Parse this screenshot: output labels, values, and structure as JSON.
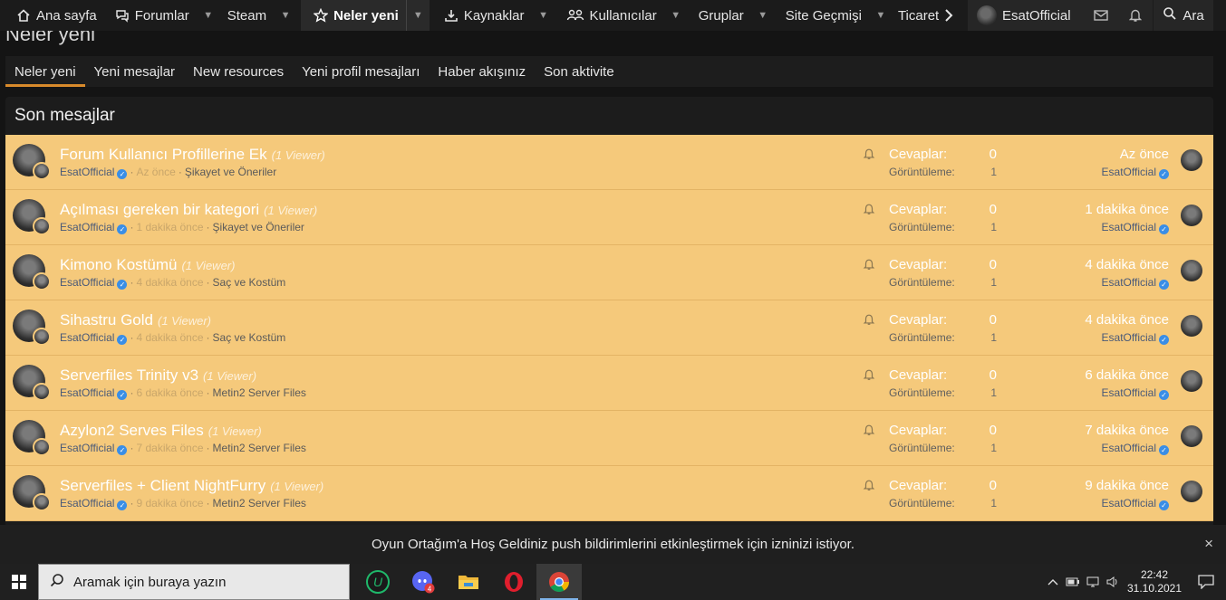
{
  "nav": {
    "home": "Ana sayfa",
    "forums": "Forumlar",
    "steam": "Steam",
    "whats_new": "Neler yeni",
    "resources": "Kaynaklar",
    "members": "Kullanıcılar",
    "groups": "Gruplar",
    "site_history": "Site Geçmişi",
    "trade": "Ticaret",
    "user": "EsatOfficial",
    "search": "Ara"
  },
  "page_heading": "Neler yeni",
  "tabs": [
    "Neler yeni",
    "Yeni mesajlar",
    "New resources",
    "Yeni profil mesajları",
    "Haber akışınız",
    "Son aktivite"
  ],
  "block_title": "Son mesajlar",
  "labels": {
    "replies": "Cevaplar:",
    "views": "Görüntüleme:"
  },
  "threads": [
    {
      "title": "Forum Kullanıcı Profillerine Ek",
      "viewers": "(1 Viewer)",
      "author": "EsatOfficial",
      "time": "Az önce",
      "forum": "Şikayet ve Öneriler",
      "replies": "0",
      "views": "1",
      "last_time": "Az önce",
      "last_user": "EsatOfficial"
    },
    {
      "title": "Açılması gereken bir kategori",
      "viewers": "(1 Viewer)",
      "author": "EsatOfficial",
      "time": "1 dakika önce",
      "forum": "Şikayet ve Öneriler",
      "replies": "0",
      "views": "1",
      "last_time": "1 dakika önce",
      "last_user": "EsatOfficial"
    },
    {
      "title": "Kimono Kostümü",
      "viewers": "(1 Viewer)",
      "author": "EsatOfficial",
      "time": "4 dakika önce",
      "forum": "Saç ve Kostüm",
      "replies": "0",
      "views": "1",
      "last_time": "4 dakika önce",
      "last_user": "EsatOfficial"
    },
    {
      "title": "Sihastru Gold",
      "viewers": "(1 Viewer)",
      "author": "EsatOfficial",
      "time": "4 dakika önce",
      "forum": "Saç ve Kostüm",
      "replies": "0",
      "views": "1",
      "last_time": "4 dakika önce",
      "last_user": "EsatOfficial"
    },
    {
      "title": "Serverfiles Trinity v3",
      "viewers": "(1 Viewer)",
      "author": "EsatOfficial",
      "time": "6 dakika önce",
      "forum": "Metin2 Server Files",
      "replies": "0",
      "views": "1",
      "last_time": "6 dakika önce",
      "last_user": "EsatOfficial"
    },
    {
      "title": "Azylon2 Serves Files",
      "viewers": "(1 Viewer)",
      "author": "EsatOfficial",
      "time": "7 dakika önce",
      "forum": "Metin2 Server Files",
      "replies": "0",
      "views": "1",
      "last_time": "7 dakika önce",
      "last_user": "EsatOfficial"
    },
    {
      "title": "Serverfiles + Client NightFurry",
      "viewers": "(1 Viewer)",
      "author": "EsatOfficial",
      "time": "9 dakika önce",
      "forum": "Metin2 Server Files",
      "replies": "0",
      "views": "1",
      "last_time": "9 dakika önce",
      "last_user": "EsatOfficial"
    }
  ],
  "push_notice": "Oyun Ortağım'a Hoş Geldiniz push bildirimlerini etkinleştirmek için izninizi istiyor.",
  "push_close": "×",
  "taskbar": {
    "search_placeholder": "Aramak için buraya yazın",
    "discord_badge": "4",
    "time": "22:42",
    "date": "31.10.2021"
  },
  "colors": {
    "row_bg": "#f5c97b",
    "accent": "#d88a2b",
    "nav_bg": "#1b1b1b"
  },
  "icons": [
    "home-icon",
    "forums-icon",
    "star-icon",
    "resources-icon",
    "members-icon",
    "mail-icon",
    "bell-icon",
    "search-icon",
    "windows-icon",
    "discord-icon",
    "folder-icon",
    "opera-icon",
    "chrome-icon"
  ]
}
